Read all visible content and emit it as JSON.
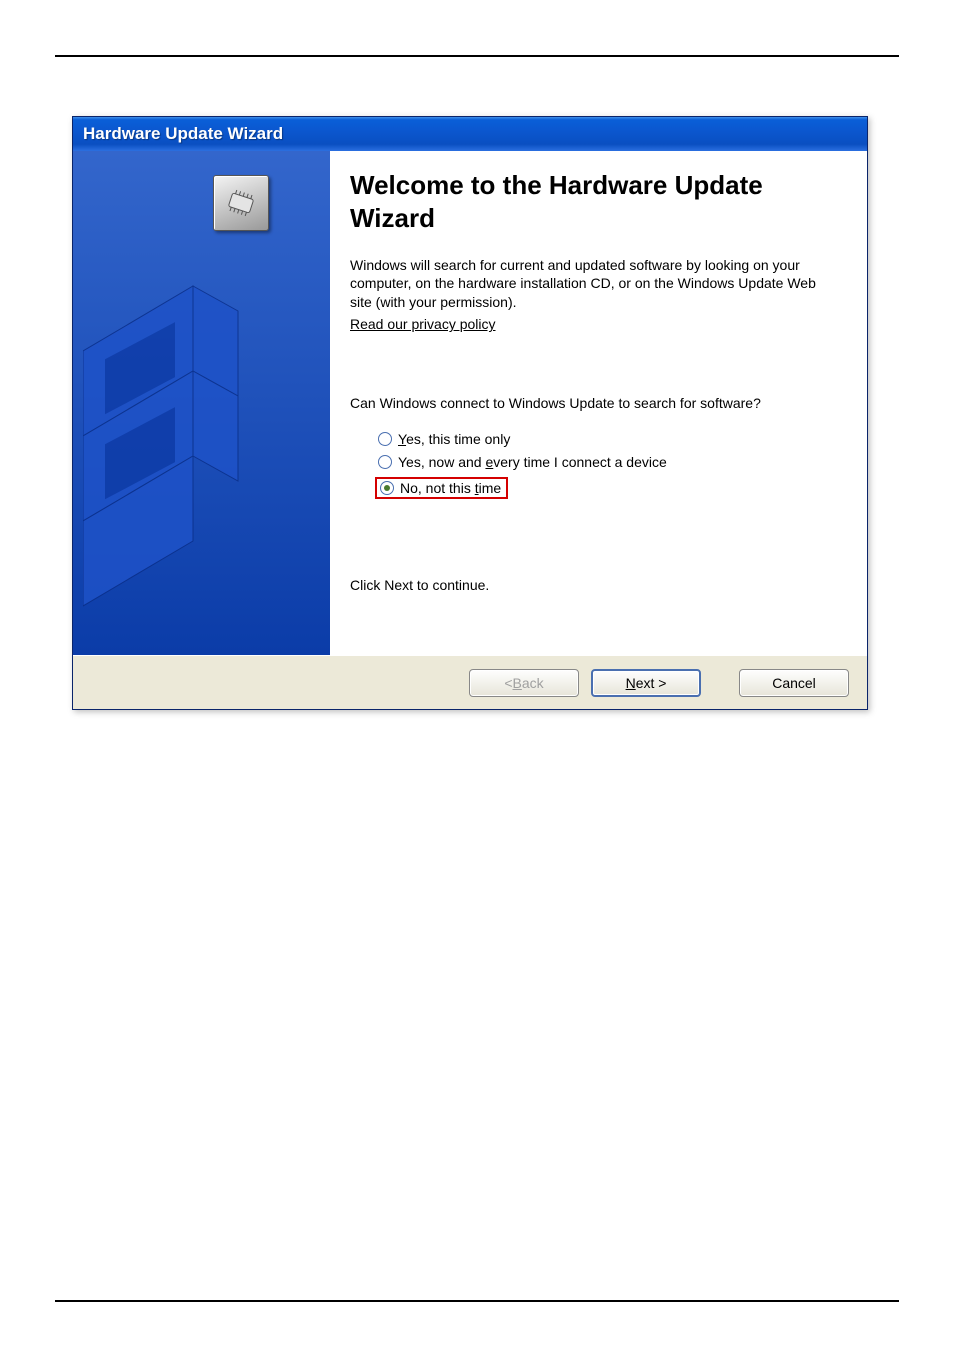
{
  "title_bar": "Hardware Update Wizard",
  "heading": "Welcome to the Hardware Update Wizard",
  "intro": "Windows will search for current and updated software by looking on your computer, on the hardware installation CD, or on the Windows Update Web site (with your permission).",
  "privacy_link": "Read our privacy policy",
  "question": "Can Windows connect to Windows Update to search for software?",
  "radios": {
    "opt1": {
      "pre": "",
      "u": "Y",
      "post": "es, this time only",
      "selected": false
    },
    "opt2": {
      "pre": "Yes, now and ",
      "u": "e",
      "post": "very time I connect a device",
      "selected": false
    },
    "opt3": {
      "pre": "No, not this ",
      "u": "t",
      "post": "ime",
      "selected": true
    }
  },
  "continue_text": "Click Next to continue.",
  "buttons": {
    "back": {
      "lt": "< ",
      "u": "B",
      "post": "ack",
      "enabled": false
    },
    "next": {
      "u": "N",
      "post": "ext >",
      "enabled": true,
      "default": true
    },
    "cancel": {
      "label": "Cancel",
      "enabled": true
    }
  }
}
